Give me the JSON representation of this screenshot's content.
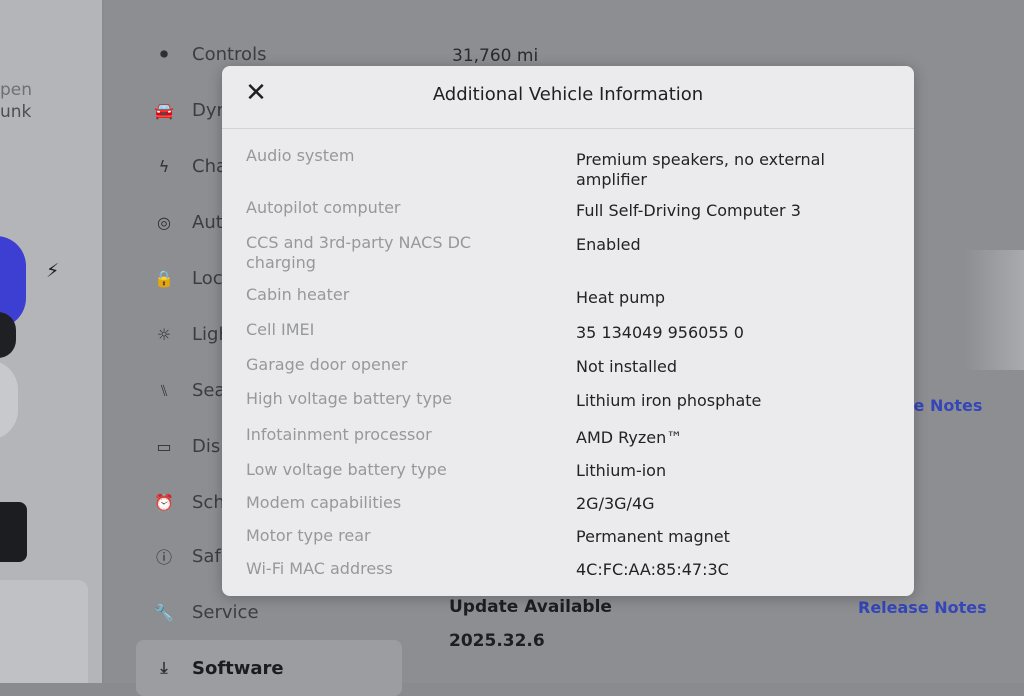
{
  "car_panel": {
    "text_partial_1": "pen",
    "text_partial_2": "unk"
  },
  "settings": {
    "nav": [
      {
        "label": "Controls",
        "icon": "toggle-icon"
      },
      {
        "label": "Dyn",
        "icon": "car-icon"
      },
      {
        "label": "Cha",
        "icon": "bolt-icon"
      },
      {
        "label": "Aut",
        "icon": "steering-wheel-icon"
      },
      {
        "label": "Loc",
        "icon": "lock-icon"
      },
      {
        "label": "Ligh",
        "icon": "light-icon"
      },
      {
        "label": "Sea",
        "icon": "seat-icon"
      },
      {
        "label": "Dis",
        "icon": "display-icon"
      },
      {
        "label": "Sch",
        "icon": "alarm-clock-icon"
      },
      {
        "label": "Saf",
        "icon": "alert-icon"
      },
      {
        "label": "Service",
        "icon": "wrench-icon"
      },
      {
        "label": "Software",
        "icon": "download-icon"
      }
    ],
    "mileage": "31,760 mi",
    "release_notes_partial": "se Notes",
    "update_available": "Update Available",
    "version": "2025.32.6",
    "release_notes": "Release Notes"
  },
  "modal": {
    "title": "Additional Vehicle Information",
    "close_icon": "close-icon",
    "rows": [
      {
        "label": "Audio system",
        "value": "Premium speakers, no external amplifier"
      },
      {
        "label": "Autopilot computer",
        "value": "Full Self-Driving Computer 3"
      },
      {
        "label": "CCS and 3rd-party NACS DC charging",
        "value": "Enabled"
      },
      {
        "label": "Cabin heater",
        "value": "Heat pump"
      },
      {
        "label": "Cell IMEI",
        "value": "35 134049 956055 0"
      },
      {
        "label": "Garage door opener",
        "value": "Not installed"
      },
      {
        "label": "High voltage battery type",
        "value": "Lithium iron phosphate"
      },
      {
        "label": "Infotainment processor",
        "value": "AMD Ryzen™"
      },
      {
        "label": "Low voltage battery type",
        "value": "Lithium-ion"
      },
      {
        "label": "Modem capabilities",
        "value": "2G/3G/4G"
      },
      {
        "label": "Motor type rear",
        "value": "Permanent magnet"
      },
      {
        "label": "Wi-Fi MAC address",
        "value": "4C:FC:AA:85:47:3C"
      }
    ]
  },
  "colors": {
    "link": "#3446b8",
    "modal_bg": "#ebebed",
    "label_gray": "#97989c",
    "car_blue": "#3c3fd2"
  }
}
